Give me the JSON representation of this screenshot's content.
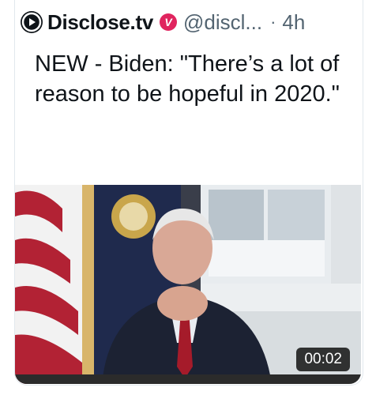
{
  "tweet": {
    "author_name": "Disclose.tv",
    "verified_badge_letter": "V",
    "handle": "@discl...",
    "separator": "·",
    "time_ago": "4h",
    "text": "NEW - Biden: \"There’s a lot of reason to be hopeful in 2020.\""
  },
  "media": {
    "type": "video",
    "duration": "00:02"
  },
  "colors": {
    "verified_badge": "#e0245e",
    "secondary_text": "#536471",
    "border": "#e1e8ed"
  },
  "icons": {
    "logo": "play-circle-logo-icon"
  }
}
